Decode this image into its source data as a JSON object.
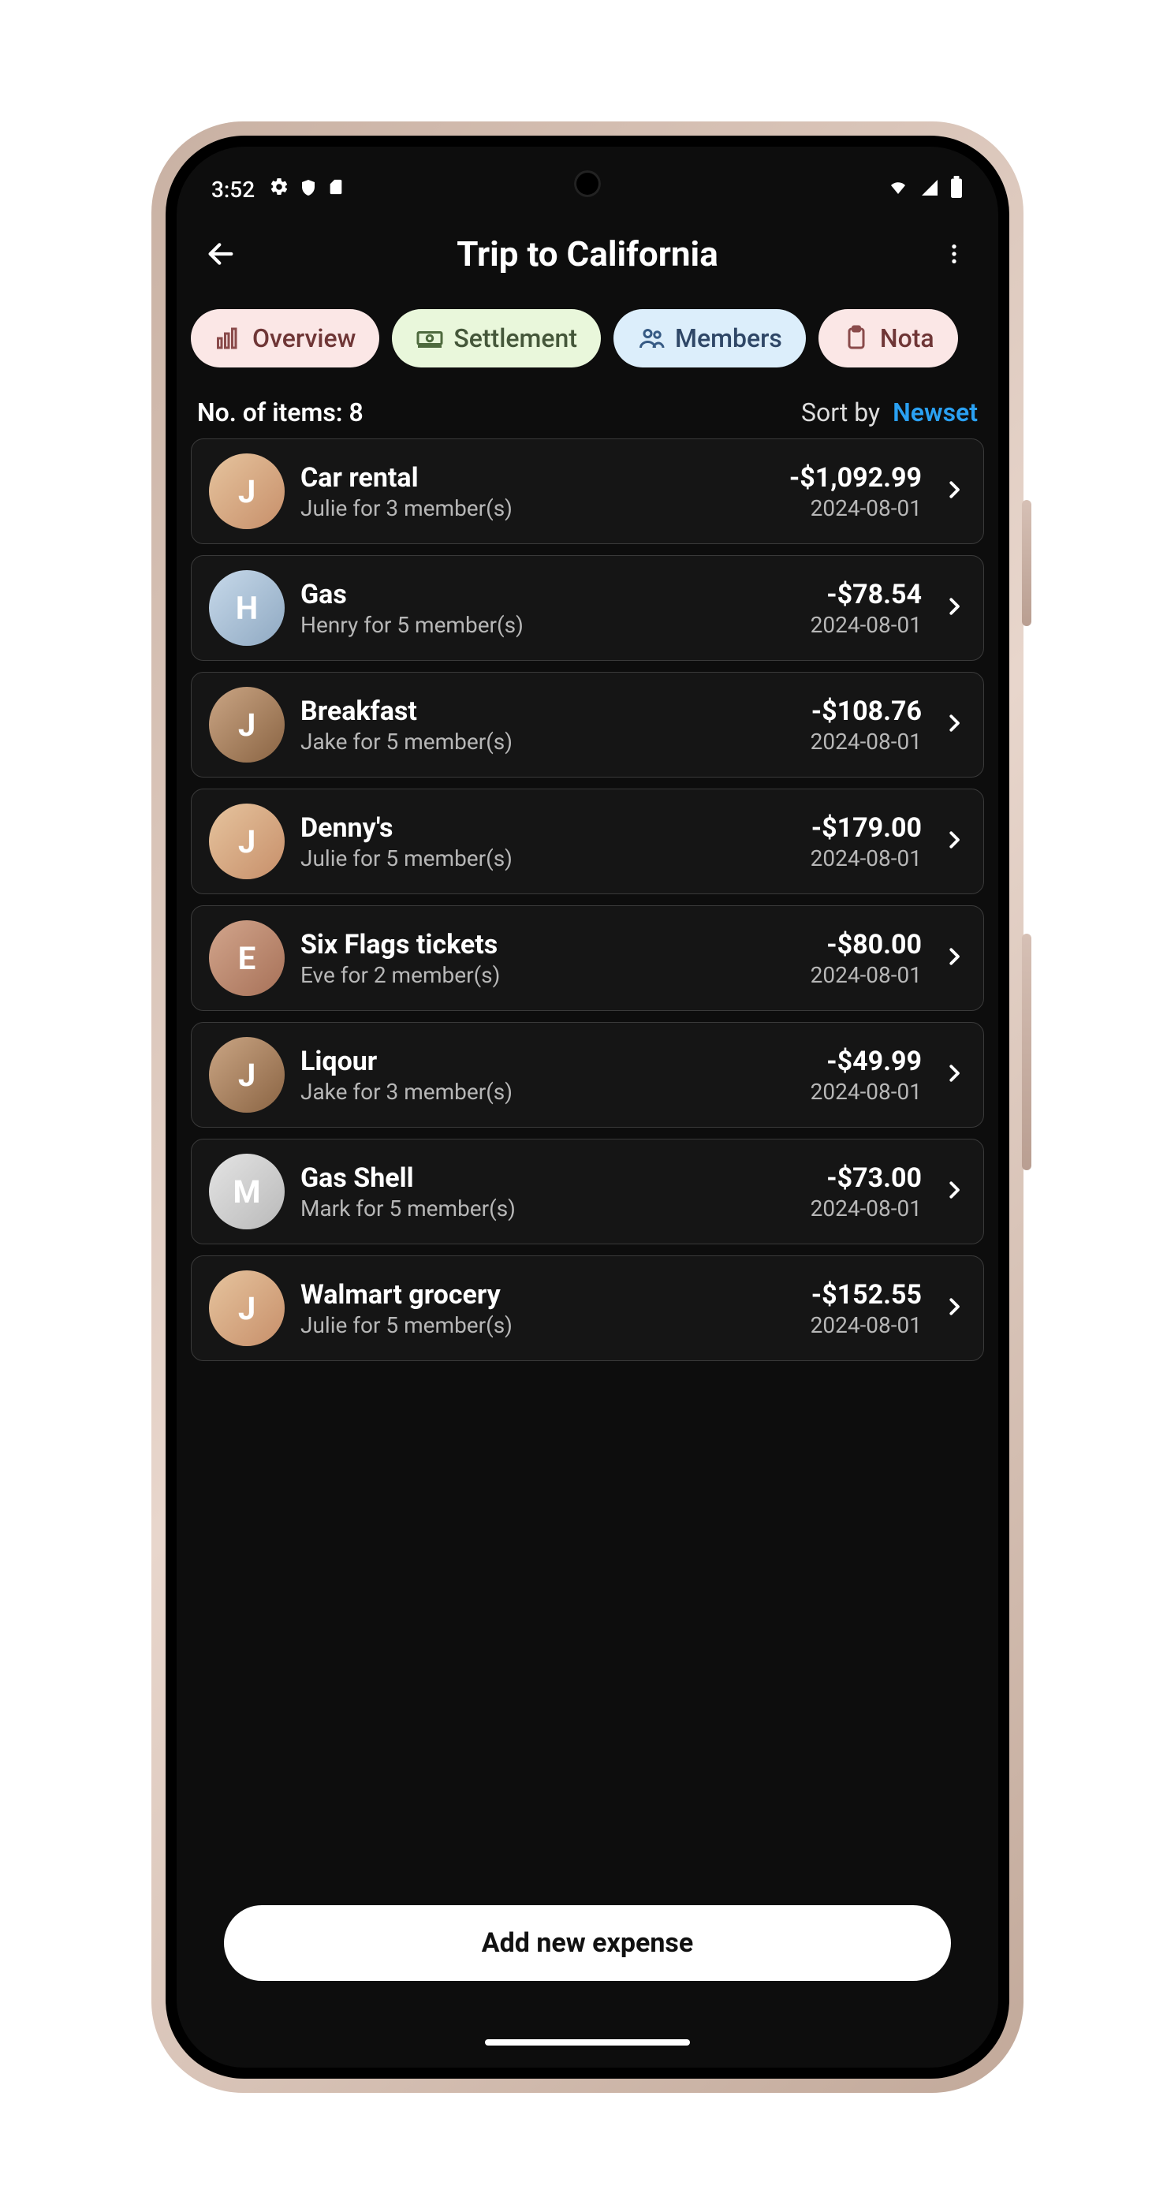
{
  "status": {
    "time": "3:52"
  },
  "header": {
    "title": "Trip to California"
  },
  "tabs": {
    "overview": "Overview",
    "settlement": "Settlement",
    "members": "Members",
    "notes": "Nota"
  },
  "summary": {
    "count_label": "No. of items: 8",
    "sort_label": "Sort by",
    "sort_value": "Newset"
  },
  "expenses": [
    {
      "title": "Car rental",
      "subtitle": "Julie for 3 member(s)",
      "amount": "-$1,092.99",
      "date": "2024-08-01",
      "avatar": "julie",
      "initial": "J"
    },
    {
      "title": "Gas",
      "subtitle": "Henry for 5 member(s)",
      "amount": "-$78.54",
      "date": "2024-08-01",
      "avatar": "henry",
      "initial": "H"
    },
    {
      "title": "Breakfast",
      "subtitle": "Jake for 5 member(s)",
      "amount": "-$108.76",
      "date": "2024-08-01",
      "avatar": "jake",
      "initial": "J"
    },
    {
      "title": "Denny's",
      "subtitle": "Julie for 5 member(s)",
      "amount": "-$179.00",
      "date": "2024-08-01",
      "avatar": "julie",
      "initial": "J"
    },
    {
      "title": "Six Flags tickets",
      "subtitle": "Eve for 2 member(s)",
      "amount": "-$80.00",
      "date": "2024-08-01",
      "avatar": "eve",
      "initial": "E"
    },
    {
      "title": "Liqour",
      "subtitle": "Jake for 3 member(s)",
      "amount": "-$49.99",
      "date": "2024-08-01",
      "avatar": "jake",
      "initial": "J"
    },
    {
      "title": "Gas Shell",
      "subtitle": "Mark for 5 member(s)",
      "amount": "-$73.00",
      "date": "2024-08-01",
      "avatar": "mark",
      "initial": "M"
    },
    {
      "title": "Walmart grocery",
      "subtitle": "Julie for 5 member(s)",
      "amount": "-$152.55",
      "date": "2024-08-01",
      "avatar": "julie",
      "initial": "J"
    }
  ],
  "cta": {
    "add_expense": "Add new expense"
  }
}
